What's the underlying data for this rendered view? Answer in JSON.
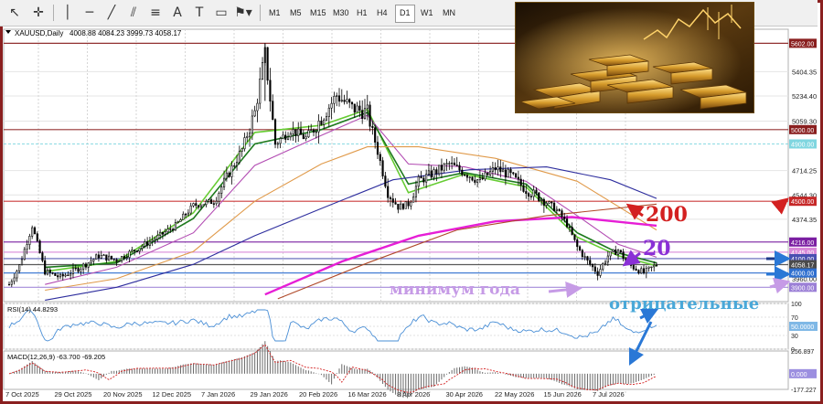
{
  "toolbar": {
    "timeframes": [
      "M1",
      "M5",
      "M15",
      "M30",
      "H1",
      "H4",
      "D1",
      "W1",
      "MN"
    ],
    "active_timeframe": "D1"
  },
  "chart_data": {
    "type": "candlestick",
    "symbol_label": "XAUUSD,Daily",
    "ohlc_label": "4008.88 4084.23 3999.73 4058.17",
    "y_ticks": [
      "5602.00",
      "5404.35",
      "5234.40",
      "5059.30",
      "4714.25",
      "4544.30",
      "4374.35",
      "4058.17",
      "3960.00"
    ],
    "ylim": [
      3800,
      5700
    ],
    "price_tags": [
      {
        "value": 5602.0,
        "label": "5602.00",
        "color": "#8a1f1f"
      },
      {
        "value": 5000.0,
        "label": "5000.00",
        "color": "#8a1f1f"
      },
      {
        "value": 4900.0,
        "label": "4900.00",
        "color": "#7fd6e0"
      },
      {
        "value": 4500.0,
        "label": "4500.00",
        "color": "#c62828"
      },
      {
        "value": 4216.0,
        "label": "4216.00",
        "color": "#7b1fa2"
      },
      {
        "value": 4145.0,
        "label": "4145.00",
        "color": "#d98ad9"
      },
      {
        "value": 4100.0,
        "label": "4100.00",
        "color": "#4a4fb0"
      },
      {
        "value": 4058.17,
        "label": "4058.17",
        "color": "#4a4a4a"
      },
      {
        "value": 4000.0,
        "label": "4000.00",
        "color": "#2f6fcf"
      },
      {
        "value": 3900.0,
        "label": "3900.00",
        "color": "#9b7fd6"
      }
    ],
    "x_labels": [
      "7 Oct 2025",
      "29 Oct 2025",
      "20 Nov 2025",
      "12 Dec 2025",
      "7 Jan 2026",
      "29 Jan 2026",
      "20 Feb 2026",
      "16 Mar 2026",
      "8 Apr 2026",
      "30 Apr 2026",
      "22 May 2026",
      "15 Jun 2026",
      "7 Jul 2026"
    ],
    "close_path": [
      {
        "x": 0,
        "y": 3920
      },
      {
        "x": 4,
        "y": 4050
      },
      {
        "x": 9,
        "y": 4330
      },
      {
        "x": 14,
        "y": 4010
      },
      {
        "x": 20,
        "y": 3970
      },
      {
        "x": 28,
        "y": 4040
      },
      {
        "x": 35,
        "y": 4120
      },
      {
        "x": 42,
        "y": 4090
      },
      {
        "x": 50,
        "y": 4170
      },
      {
        "x": 58,
        "y": 4250
      },
      {
        "x": 65,
        "y": 4330
      },
      {
        "x": 72,
        "y": 4470
      },
      {
        "x": 80,
        "y": 4500
      },
      {
        "x": 86,
        "y": 4700
      },
      {
        "x": 91,
        "y": 4860
      },
      {
        "x": 96,
        "y": 5120
      },
      {
        "x": 100,
        "y": 5530
      },
      {
        "x": 104,
        "y": 4900
      },
      {
        "x": 110,
        "y": 5000
      },
      {
        "x": 116,
        "y": 4940
      },
      {
        "x": 122,
        "y": 5080
      },
      {
        "x": 128,
        "y": 5240
      },
      {
        "x": 134,
        "y": 5150
      },
      {
        "x": 140,
        "y": 5120
      },
      {
        "x": 144,
        "y": 4850
      },
      {
        "x": 148,
        "y": 4560
      },
      {
        "x": 152,
        "y": 4460
      },
      {
        "x": 156,
        "y": 4480
      },
      {
        "x": 160,
        "y": 4640
      },
      {
        "x": 166,
        "y": 4700
      },
      {
        "x": 172,
        "y": 4760
      },
      {
        "x": 178,
        "y": 4700
      },
      {
        "x": 184,
        "y": 4640
      },
      {
        "x": 190,
        "y": 4730
      },
      {
        "x": 196,
        "y": 4680
      },
      {
        "x": 202,
        "y": 4580
      },
      {
        "x": 208,
        "y": 4520
      },
      {
        "x": 214,
        "y": 4440
      },
      {
        "x": 218,
        "y": 4340
      },
      {
        "x": 222,
        "y": 4180
      },
      {
        "x": 226,
        "y": 4080
      },
      {
        "x": 230,
        "y": 4000
      },
      {
        "x": 234,
        "y": 4120
      },
      {
        "x": 238,
        "y": 4160
      },
      {
        "x": 242,
        "y": 4060
      },
      {
        "x": 248,
        "y": 4000
      },
      {
        "x": 253,
        "y": 4058
      }
    ],
    "series": [
      {
        "name": "MA fast",
        "color": "#66cc33",
        "values": [
          [
            14,
            4010
          ],
          [
            42,
            4080
          ],
          [
            72,
            4420
          ],
          [
            96,
            4980
          ],
          [
            122,
            5030
          ],
          [
            140,
            5140
          ],
          [
            156,
            4560
          ],
          [
            178,
            4690
          ],
          [
            202,
            4600
          ],
          [
            222,
            4250
          ],
          [
            238,
            4120
          ],
          [
            253,
            4050
          ]
        ]
      },
      {
        "name": "MA 20",
        "color": "#1e7a1e",
        "values": [
          [
            14,
            4040
          ],
          [
            42,
            4070
          ],
          [
            72,
            4380
          ],
          [
            96,
            4900
          ],
          [
            122,
            5000
          ],
          [
            140,
            5120
          ],
          [
            156,
            4620
          ],
          [
            178,
            4700
          ],
          [
            202,
            4620
          ],
          [
            222,
            4280
          ],
          [
            238,
            4140
          ],
          [
            253,
            4070
          ]
        ]
      },
      {
        "name": "MA 50",
        "color": "#b34db3",
        "values": [
          [
            14,
            3920
          ],
          [
            42,
            4040
          ],
          [
            72,
            4280
          ],
          [
            96,
            4750
          ],
          [
            122,
            4960
          ],
          [
            140,
            5100
          ],
          [
            156,
            4760
          ],
          [
            178,
            4740
          ],
          [
            202,
            4640
          ],
          [
            222,
            4400
          ],
          [
            238,
            4200
          ],
          [
            253,
            4110
          ]
        ]
      },
      {
        "name": "MA 100",
        "color": "#e09a4a",
        "values": [
          [
            14,
            3880
          ],
          [
            42,
            3960
          ],
          [
            72,
            4150
          ],
          [
            96,
            4500
          ],
          [
            122,
            4760
          ],
          [
            140,
            4880
          ],
          [
            160,
            4880
          ],
          [
            190,
            4800
          ],
          [
            222,
            4640
          ],
          [
            253,
            4300
          ]
        ]
      },
      {
        "name": "MA 120",
        "color": "#2e2e9e",
        "values": [
          [
            14,
            3810
          ],
          [
            42,
            3900
          ],
          [
            72,
            4060
          ],
          [
            96,
            4260
          ],
          [
            122,
            4450
          ],
          [
            150,
            4650
          ],
          [
            180,
            4720
          ],
          [
            210,
            4740
          ],
          [
            235,
            4650
          ],
          [
            253,
            4520
          ]
        ]
      },
      {
        "name": "MA 200",
        "color": "#e61ed6",
        "values": [
          [
            100,
            3850
          ],
          [
            130,
            4080
          ],
          [
            160,
            4260
          ],
          [
            190,
            4360
          ],
          [
            220,
            4390
          ],
          [
            253,
            4330
          ]
        ]
      },
      {
        "name": "MA 300",
        "color": "#b04a2a",
        "values": [
          [
            105,
            3820
          ],
          [
            140,
            4070
          ],
          [
            175,
            4300
          ],
          [
            210,
            4400
          ],
          [
            253,
            4480
          ]
        ]
      }
    ],
    "rsi": {
      "label": "RSI(14) 44.8293",
      "levels": [
        "100",
        "70",
        "50.0000",
        "30",
        "0"
      ]
    },
    "macd": {
      "label": "MACD(12,26,9) -63.700 -69.205",
      "levels": [
        "256.897",
        "0.000",
        "-177.227"
      ]
    }
  },
  "annotations": {
    "ma200": "200",
    "ma20": "20",
    "year_low": "минимум года",
    "negative": "отрицательные"
  }
}
